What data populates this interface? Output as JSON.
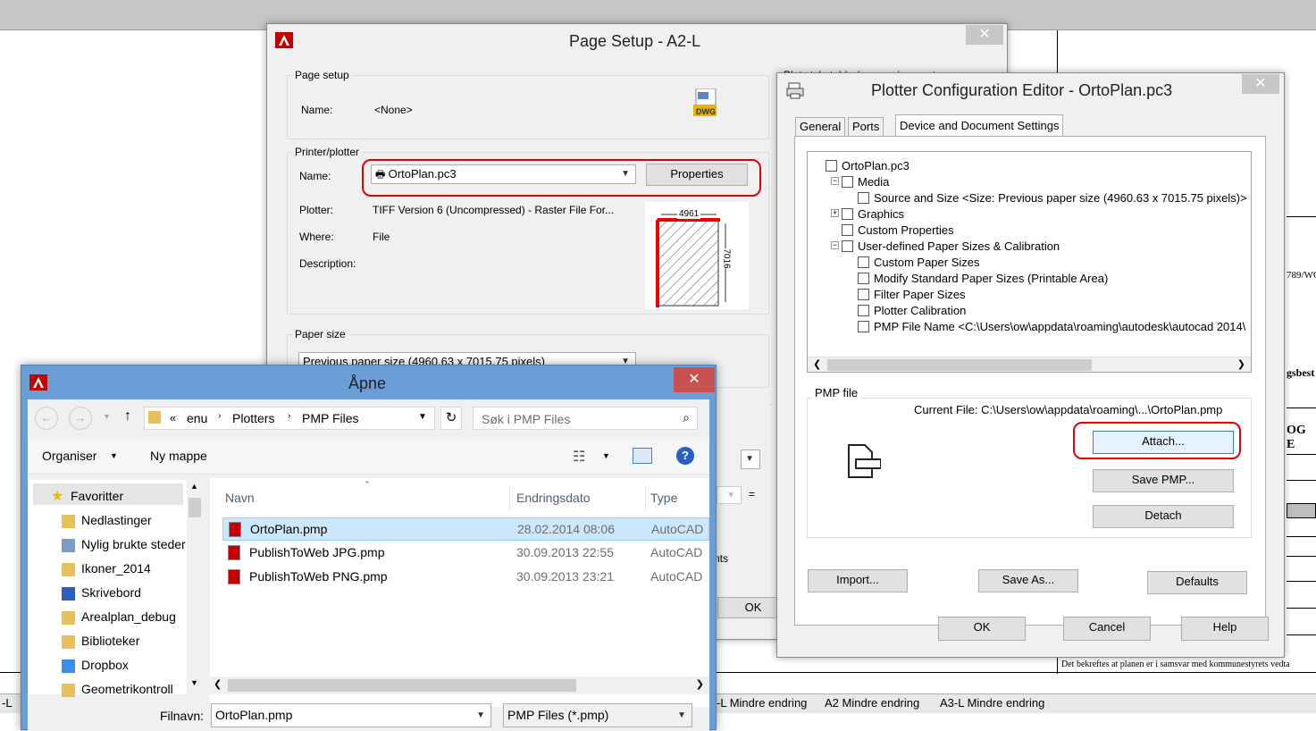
{
  "page_setup": {
    "title": "Page Setup - A2-L",
    "page_setup_group": "Page setup",
    "name_label": "Name:",
    "name_value": "<None>",
    "printer_group": "Printer/plotter",
    "printer_name_label": "Name:",
    "printer_name_value": "OrtoPlan.pc3",
    "properties_button": "Properties",
    "plotter_label": "Plotter:",
    "plotter_value": "TIFF Version 6 (Uncompressed) - Raster File For...",
    "where_label": "Where:",
    "where_value": "File",
    "description_label": "Description:",
    "preview_width": "4961",
    "preview_height": "7016",
    "paper_size_group": "Paper size",
    "paper_size_value": "Previous paper size  (4960.63 x 7015.75 pixels)",
    "plot_style_partial": "Plot style table (pen assignments)",
    "hidden_label_partial": "nts",
    "ok_button": "OK",
    "equals_sign": "="
  },
  "plotter_config": {
    "title": "Plotter Configuration Editor - OrtoPlan.pc3",
    "tabs": [
      "General",
      "Ports",
      "Device and Document Settings"
    ],
    "tree": [
      {
        "label": "OrtoPlan.pc3",
        "indent": 0,
        "toggle": ""
      },
      {
        "label": "Media",
        "indent": 1,
        "toggle": "−"
      },
      {
        "label": "Source and Size <Size: Previous paper size  (4960.63 x 7015.75 pixels)>",
        "indent": 2,
        "toggle": ""
      },
      {
        "label": "Graphics",
        "indent": 1,
        "toggle": "+"
      },
      {
        "label": "Custom Properties",
        "indent": 1,
        "toggle": ""
      },
      {
        "label": "User-defined Paper Sizes & Calibration",
        "indent": 1,
        "toggle": "−"
      },
      {
        "label": "Custom Paper Sizes",
        "indent": 2,
        "toggle": ""
      },
      {
        "label": "Modify Standard Paper Sizes (Printable Area)",
        "indent": 2,
        "toggle": ""
      },
      {
        "label": "Filter Paper Sizes",
        "indent": 2,
        "toggle": ""
      },
      {
        "label": "Plotter Calibration",
        "indent": 2,
        "toggle": ""
      },
      {
        "label": "PMP File Name <C:\\Users\\ow\\appdata\\roaming\\autodesk\\autocad 2014\\",
        "indent": 2,
        "toggle": ""
      }
    ],
    "pmp_group": "PMP file",
    "current_file": "Current File: C:\\Users\\ow\\appdata\\roaming\\...\\OrtoPlan.pmp",
    "attach_button": "Attach...",
    "save_pmp_button": "Save PMP...",
    "detach_button": "Detach",
    "import_button": "Import...",
    "save_as_button": "Save As...",
    "defaults_button": "Defaults",
    "ok_button": "OK",
    "cancel_button": "Cancel",
    "help_button": "Help"
  },
  "open_dialog": {
    "title": "Åpne",
    "breadcrumb": [
      "«",
      "enu",
      "Plotters",
      "PMP Files"
    ],
    "search_placeholder": "Søk i PMP Files",
    "organize": "Organiser",
    "new_folder": "Ny mappe",
    "nav": [
      {
        "label": "Favoritter",
        "icon": "star-icon"
      },
      {
        "label": "Nedlastinger",
        "icon": "folder-icon"
      },
      {
        "label": "Nylig brukte steder",
        "icon": "recent-icon"
      },
      {
        "label": "Ikoner_2014",
        "icon": "folder-icon"
      },
      {
        "label": "Skrivebord",
        "icon": "desktop-icon"
      },
      {
        "label": "Arealplan_debug",
        "icon": "folder-icon"
      },
      {
        "label": "Biblioteker",
        "icon": "library-icon"
      },
      {
        "label": "Dropbox",
        "icon": "dropbox-icon"
      },
      {
        "label": "Geometrikontroll",
        "icon": "folder-icon"
      }
    ],
    "columns": [
      "Navn",
      "Endringsdato",
      "Type"
    ],
    "files": [
      {
        "name": "OrtoPlan.pmp",
        "date": "28.02.2014 08:06",
        "type": "AutoCAD",
        "selected": true
      },
      {
        "name": "PublishToWeb JPG.pmp",
        "date": "30.09.2013 22:55",
        "type": "AutoCAD",
        "selected": false
      },
      {
        "name": "PublishToWeb PNG.pmp",
        "date": "30.09.2013 23:21",
        "type": "AutoCAD",
        "selected": false
      }
    ],
    "filename_label": "Filnavn:",
    "filename_value": "OrtoPlan.pmp",
    "filter_value": "PMP Files (*.pmp)"
  },
  "layout_tabs": [
    "-L",
    "-L Mindre endring",
    "A2 Mindre endring",
    "A3-L Mindre endring"
  ],
  "background_doc": {
    "fragment1": "789/WG",
    "fragment2": "gsbest",
    "fragment3": "OG E",
    "fragment4": "Det bekreftes at planen er i samsvar med kommunestyrets vedta"
  }
}
